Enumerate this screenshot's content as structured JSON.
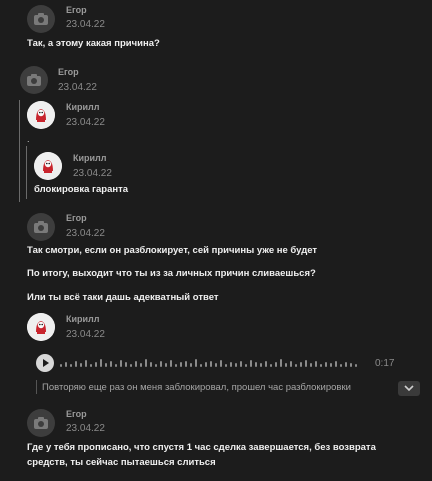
{
  "messages": [
    {
      "author": "Егор",
      "date": "23.04.22",
      "text": "Так, а этому какая причина?"
    },
    {
      "author": "Егор",
      "date": "23.04.22"
    },
    {
      "author": "Кирилл",
      "date": "23.04.22",
      "text": "."
    },
    {
      "author": "Кирилл",
      "date": "23.04.22",
      "text": "блокировка гаранта"
    },
    {
      "author": "Егор",
      "date": "23.04.22",
      "lines": [
        "Так смотри, если он разблокирует, сей причины уже не будет",
        "По итогу, выходит что ты из за личных причин сливаешься?",
        "Или ты всё таки дашь адекватный ответ"
      ]
    },
    {
      "author": "Кирилл",
      "date": "23.04.22",
      "audio": {
        "duration": "0:17",
        "transcript": "Повторяю еще раз он меня заблокировал, прошел час разблокировки"
      }
    },
    {
      "author": "Егор",
      "date": "23.04.22",
      "text": "Где у тебя прописано, что спустя 1 час сделка завершается, без возврата средств, ты сейчас пытаешься слиться"
    }
  ],
  "icons": {
    "default_avatar": "camera-icon",
    "play": "play-icon",
    "expand": "chevron-down-icon"
  }
}
